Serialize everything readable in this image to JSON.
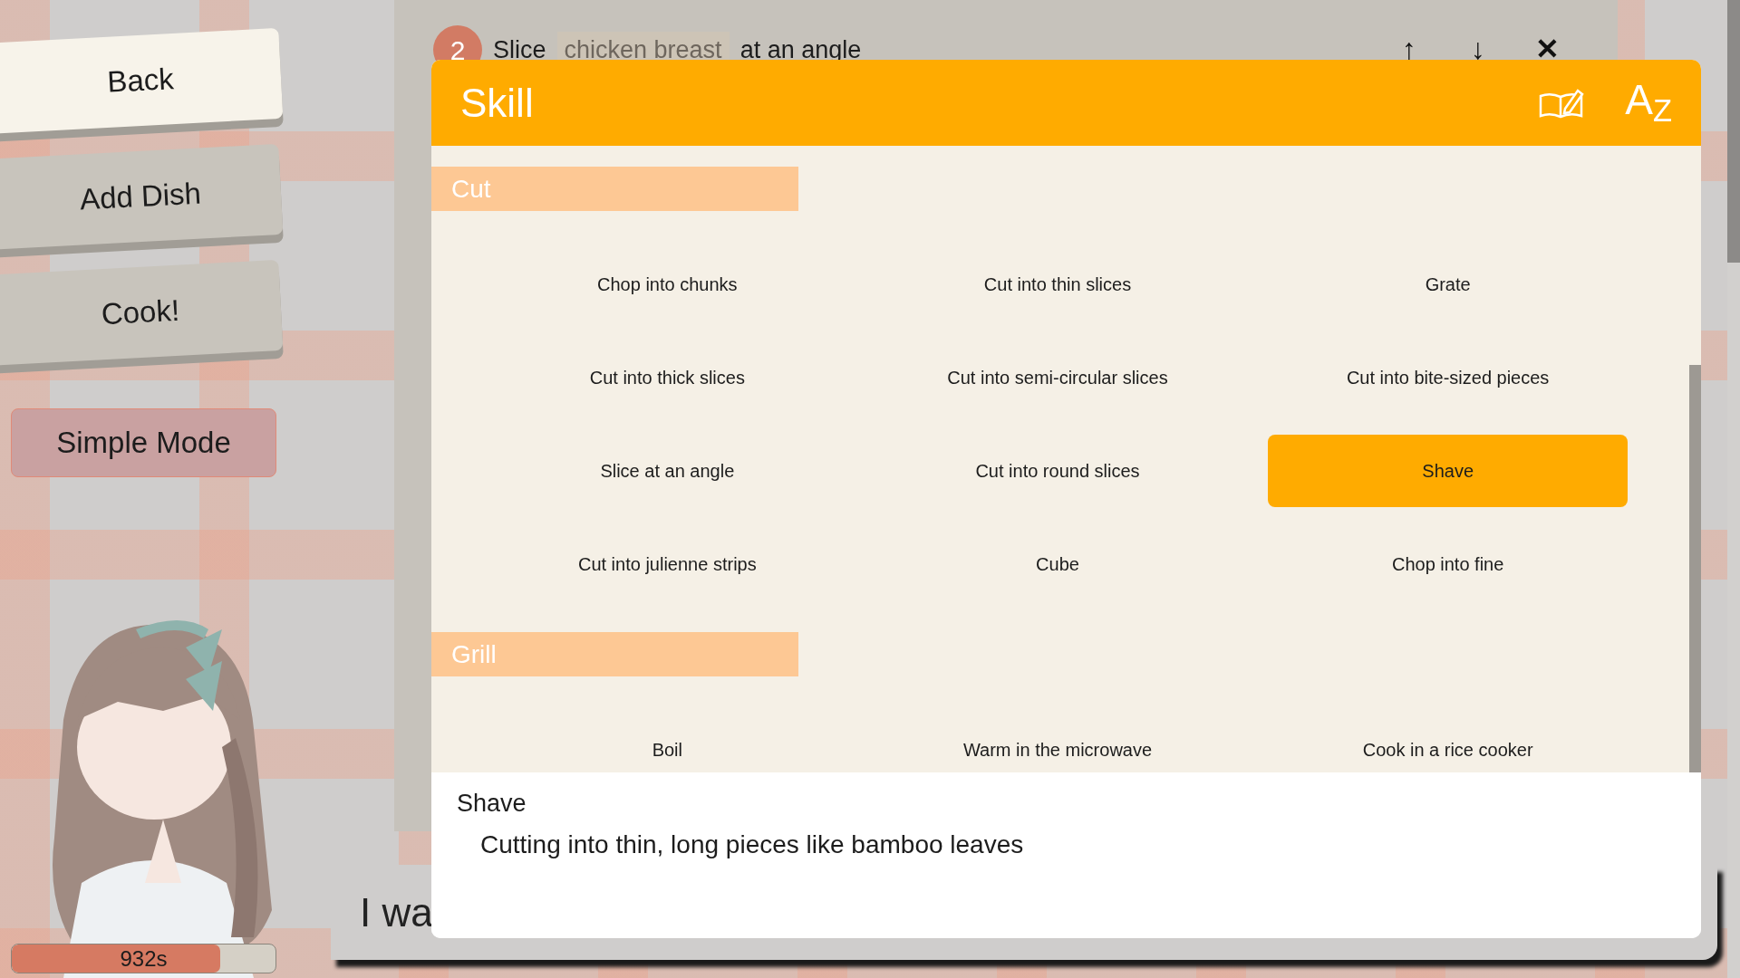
{
  "side_buttons": [
    {
      "label": "Back",
      "selected": true
    },
    {
      "label": "Add Dish",
      "selected": false
    },
    {
      "label": "Cook!",
      "selected": false
    }
  ],
  "mode_button": {
    "label": "Simple Mode"
  },
  "timer": {
    "label": "932s",
    "level": 0.79
  },
  "dialogue": {
    "text": "I wa"
  },
  "step": {
    "number": "2",
    "parts": [
      {
        "text": "Slice",
        "kind": "plain"
      },
      {
        "text": "chicken breast",
        "kind": "ingredient"
      },
      {
        "text": "at an angle",
        "kind": "plain"
      }
    ]
  },
  "step_controls": [
    "↑",
    "↓",
    "✕"
  ],
  "skill_panel": {
    "title": "Skill",
    "sort_label": "A$_{Z}$",
    "categories": [
      {
        "name": "Cut",
        "skills": [
          {
            "label": "Chop into chunks",
            "selected": false
          },
          {
            "label": "Cut into thin slices",
            "selected": false
          },
          {
            "label": "Grate",
            "selected": false
          },
          {
            "label": "Cut into thick slices",
            "selected": false
          },
          {
            "label": "Cut into semi-circular slices",
            "selected": false
          },
          {
            "label": "Cut into bite-sized pieces",
            "selected": false
          },
          {
            "label": "Slice at an angle",
            "selected": false
          },
          {
            "label": "Cut into round slices",
            "selected": false
          },
          {
            "label": "Shave",
            "selected": true
          },
          {
            "label": "Cut into julienne strips",
            "selected": false
          },
          {
            "label": "Cube",
            "selected": false
          },
          {
            "label": "Chop into fine",
            "selected": false
          }
        ]
      },
      {
        "name": "Grill",
        "skills": [
          {
            "label": "Boil",
            "selected": false
          },
          {
            "label": "Warm in the microwave",
            "selected": false
          },
          {
            "label": "Cook in a rice cooker",
            "selected": false
          }
        ]
      }
    ],
    "description": {
      "title": "Shave",
      "text": "Cutting into thin, long pieces like bamboo leaves"
    }
  }
}
